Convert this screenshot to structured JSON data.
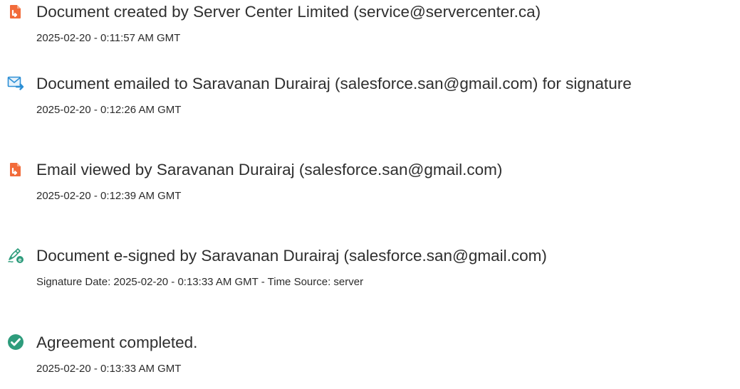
{
  "events": [
    {
      "icon": "document-orange-icon",
      "title": "Document created by Server Center Limited (service@servercenter.ca)",
      "time": "2025-02-20 - 0:11:57 AM GMT"
    },
    {
      "icon": "email-sent-icon",
      "title": "Document emailed to Saravanan Durairaj (salesforce.san@gmail.com) for signature",
      "time": "2025-02-20 - 0:12:26 AM GMT"
    },
    {
      "icon": "document-orange-icon",
      "title": "Email viewed by Saravanan Durairaj (salesforce.san@gmail.com)",
      "time": "2025-02-20 - 0:12:39 AM GMT"
    },
    {
      "icon": "esign-pen-icon",
      "title": "Document e-signed by Saravanan Durairaj (salesforce.san@gmail.com)",
      "time": "Signature Date: 2025-02-20 - 0:13:33 AM GMT - Time Source: server"
    },
    {
      "icon": "check-circle-icon",
      "title": "Agreement completed.",
      "time": "2025-02-20 - 0:13:33 AM GMT"
    }
  ],
  "colors": {
    "orange": "#f26b3a",
    "blue": "#2d8fd5",
    "green": "#2e9c7c",
    "text": "#2b2b2b"
  }
}
